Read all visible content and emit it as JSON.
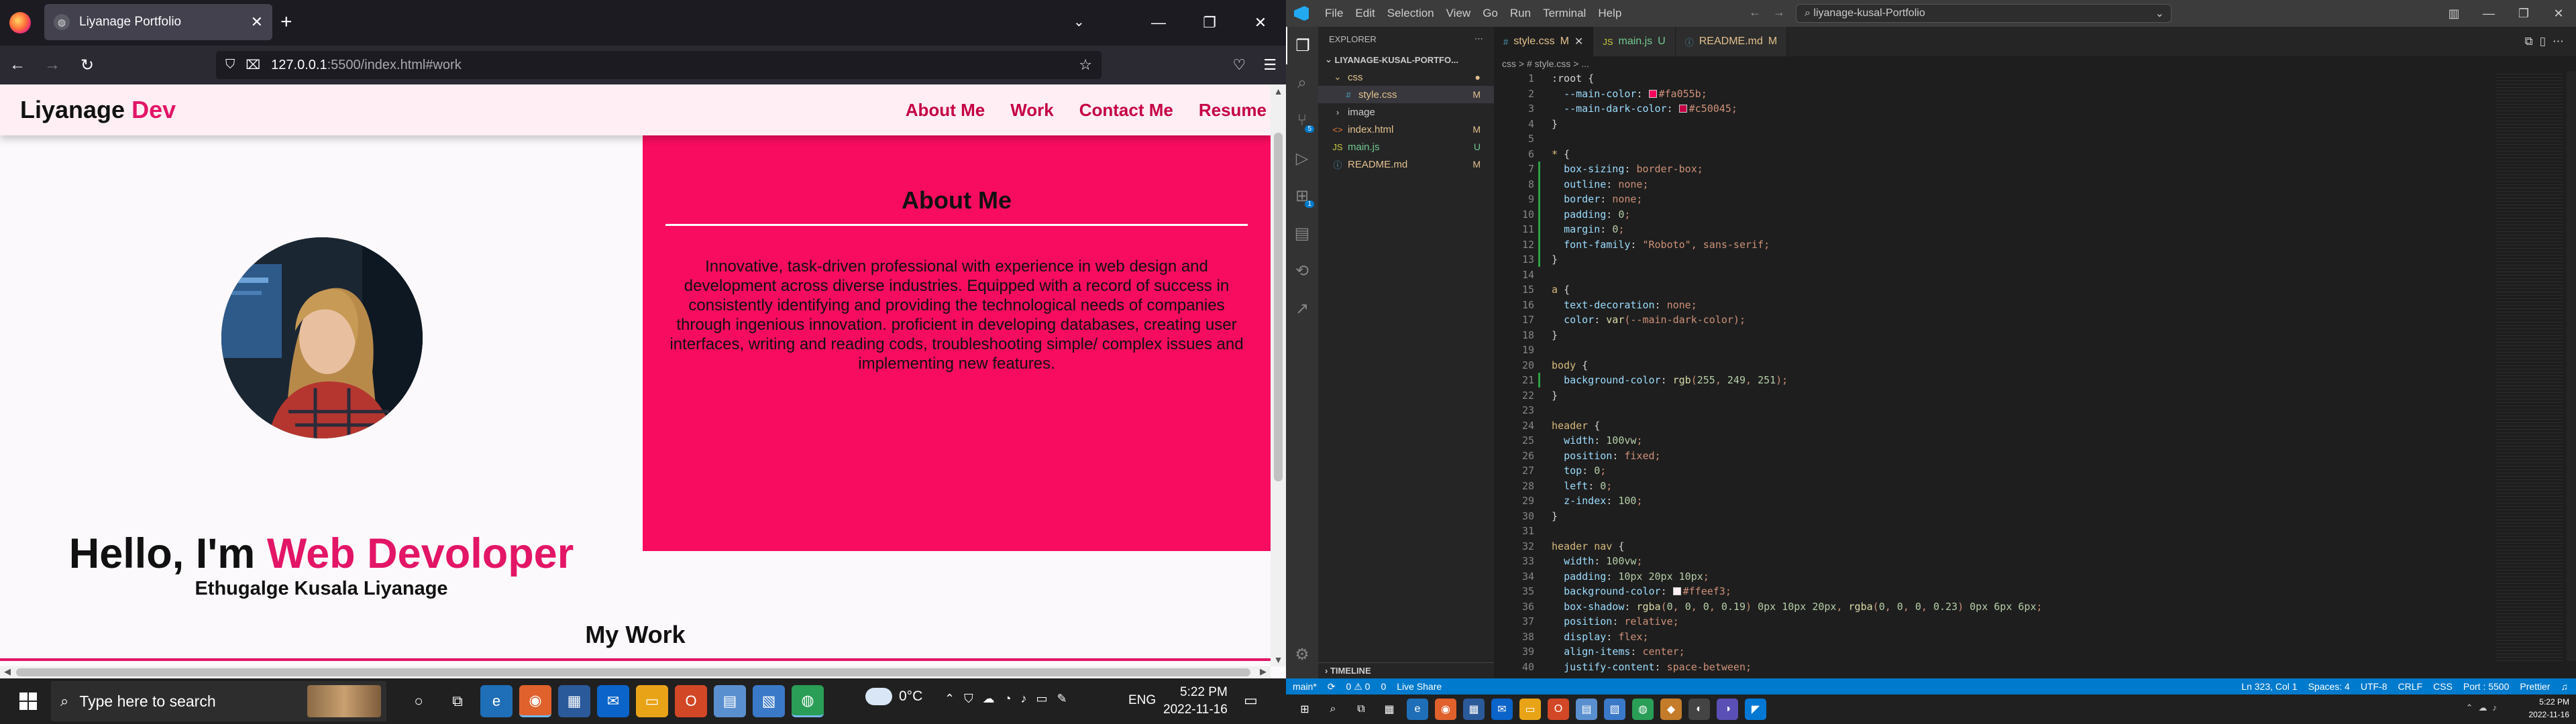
{
  "browser": {
    "tab_title": "Liyanage Portfolio",
    "url_host": "127.0.0.1",
    "url_rest": ":5500/index.html#work"
  },
  "site": {
    "brand_main": "Liyanage",
    "brand_accent": "Dev",
    "nav": [
      "About Me",
      "Work",
      "Contact Me",
      "Resume"
    ],
    "hero_prefix": "Hello, I'm",
    "hero_accent": "Web Devoloper",
    "full_name": "Ethugalge Kusala Liyanage",
    "about_title": "About Me",
    "about_text": "Innovative, task-driven professional with experience in web design and development across diverse industries. Equipped with a record of success in consistently identifying and providing the technological needs of companies through ingenious innovation. proficient in developing databases, creating user interfaces, writing and reading cods, troubleshooting simple/ complex issues and implementing new features.",
    "my_work_title": "My Work",
    "colors": {
      "accent": "#e31566",
      "about_bg": "#f80c5f",
      "nav_link": "#c50045",
      "header_bg": "#ffeef3"
    }
  },
  "vscode": {
    "menu": [
      "File",
      "Edit",
      "Selection",
      "View",
      "Go",
      "Run",
      "Terminal",
      "Help"
    ],
    "command_center": "liyanage-kusal-Portfolio",
    "explorer_label": "EXPLORER",
    "root_folder": "LIYANAGE-KUSAL-PORTFO...",
    "files": [
      {
        "name": "css",
        "status": "",
        "type": "folder"
      },
      {
        "name": "style.css",
        "status": "M",
        "type": "css"
      },
      {
        "name": "image",
        "status": "",
        "type": "folder"
      },
      {
        "name": "index.html",
        "status": "M",
        "type": "html"
      },
      {
        "name": "main.js",
        "status": "U",
        "type": "js"
      },
      {
        "name": "README.md",
        "status": "M",
        "type": "md"
      }
    ],
    "timeline_label": "TIMELINE",
    "tabs": [
      {
        "name": "style.css",
        "status": "M",
        "icon": "#"
      },
      {
        "name": "main.js",
        "status": "U",
        "icon": "JS"
      },
      {
        "name": "README.md",
        "status": "M",
        "icon": "i"
      }
    ],
    "breadcrumb": "css > # style.css > ...",
    "line_numbers": [
      "1",
      "2",
      "3",
      "4",
      "5",
      "6",
      "7",
      "8",
      "9",
      "10",
      "11",
      "12",
      "13",
      "14",
      "15",
      "16",
      "17",
      "18",
      "19",
      "20",
      "21",
      "22",
      "23",
      "24",
      "25",
      "26",
      "27",
      "28",
      "29",
      "30",
      "31",
      "32",
      "33",
      "34",
      "35",
      "36",
      "37",
      "38",
      "39",
      "40"
    ],
    "code_lines": [
      ":root {",
      "  --main-color: #fa055b;",
      "  --main-dark-color: #c50045;",
      "}",
      "",
      "* {",
      "  box-sizing: border-box;",
      "  outline: none;",
      "  border: none;",
      "  padding: 0;",
      "  margin: 0;",
      "  font-family: \"Roboto\", sans-serif;",
      "}",
      "",
      "a {",
      "  text-decoration: none;",
      "  color: var(--main-dark-color);",
      "}",
      "",
      "body {",
      "  background-color: rgb(255, 249, 251);",
      "}",
      "",
      "header {",
      "  width: 100vw;",
      "  position: fixed;",
      "  top: 0;",
      "  left: 0;",
      "  z-index: 100;",
      "}",
      "",
      "header nav {",
      "  width: 100vw;",
      "  padding: 10px 20px 10px;",
      "  background-color: #ffeef3;",
      "  box-shadow: rgba(0, 0, 0, 0.19) 0px 10px 20px, rgba(0, 0, 0, 0.23) 0px 6px 6px;",
      "  position: relative;",
      "  display: flex;",
      "  align-items: center;",
      "  justify-content: space-between;"
    ],
    "status_left": [
      "main*",
      "0 ⚠ 0",
      "0",
      "Live Share"
    ],
    "status_right": [
      "Ln 323, Col 1",
      "Spaces: 4",
      "UTF-8",
      "CRLF",
      "CSS",
      "Port : 5500",
      "Prettier"
    ],
    "colors": {
      "statusbar": "#007acc",
      "editor_bg": "#1e1e1e",
      "modified": "#e2c08d",
      "untracked": "#73c991"
    }
  },
  "taskbar": {
    "search_placeholder": "Type here to search",
    "weather": "0°C",
    "lang": "ENG",
    "time": "5:22 PM",
    "date": "2022-11-16"
  }
}
